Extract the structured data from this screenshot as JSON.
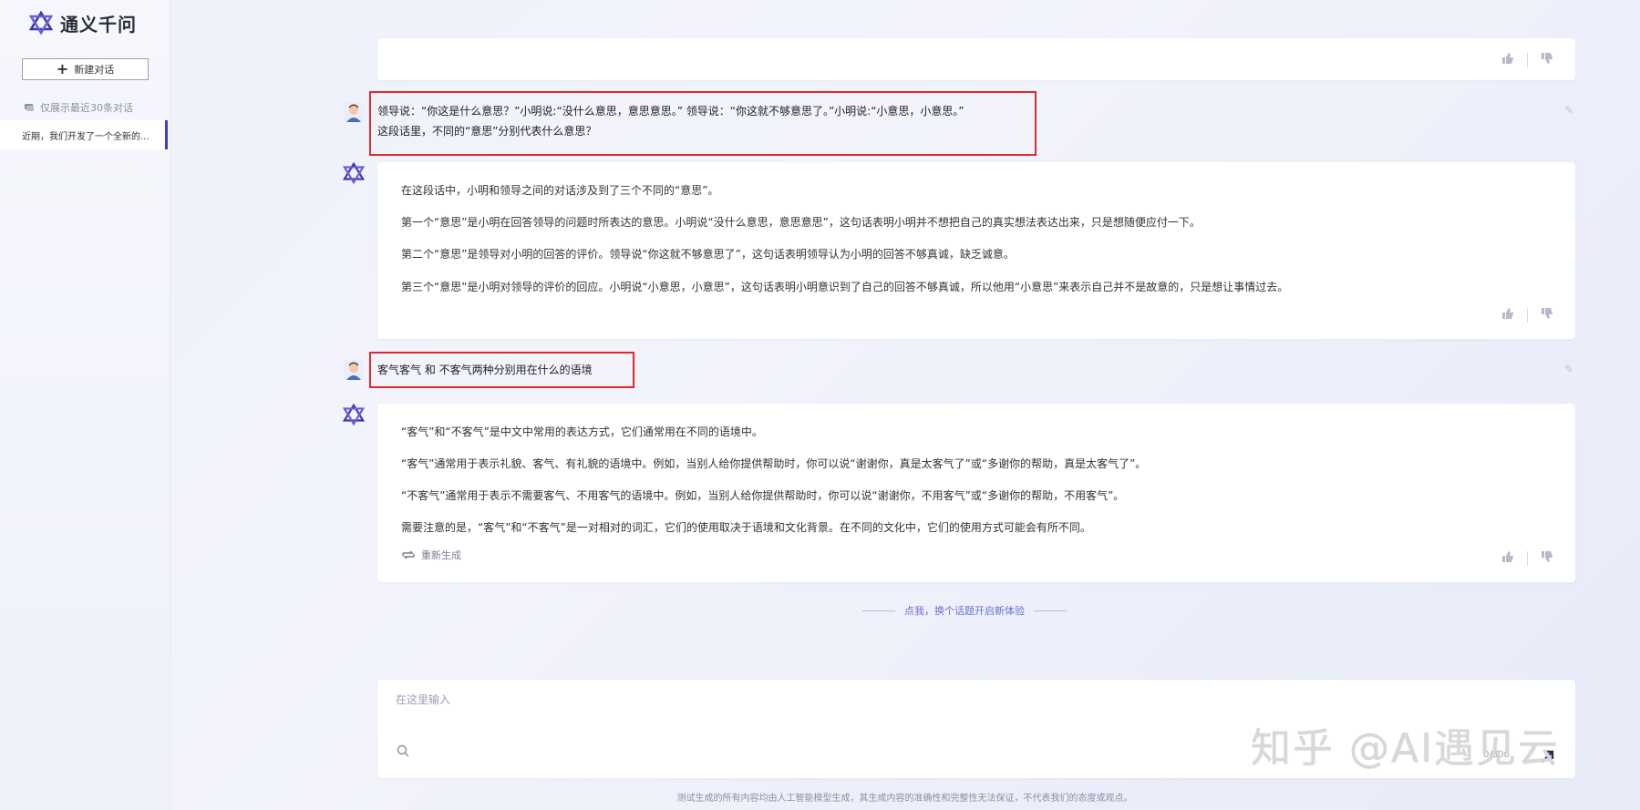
{
  "app": {
    "title": "通义千问"
  },
  "sidebar": {
    "new_chat_label": "新建对话",
    "history_note": "仅展示最近30条对话",
    "history_items": [
      "近期，我们开发了一个全新的..."
    ]
  },
  "conversation": {
    "q1": {
      "lines": [
        "领导说：“你这是什么意思？”小明说:“没什么意思，意思意思。” 领导说：“你这就不够意思了。”小明说:“小意思，小意思。”",
        "这段话里，不同的“意思”分别代表什么意思？"
      ]
    },
    "a1": {
      "paragraphs": [
        "在这段话中，小明和领导之间的对话涉及到了三个不同的“意思”。",
        "第一个“意思”是小明在回答领导的问题时所表达的意思。小明说“没什么意思，意思意思”，这句话表明小明并不想把自己的真实想法表达出来，只是想随便应付一下。",
        "第二个“意思”是领导对小明的回答的评价。领导说“你这就不够意思了”，这句话表明领导认为小明的回答不够真诚，缺乏诚意。",
        "第三个“意思”是小明对领导的评价的回应。小明说“小意思，小意思”，这句话表明小明意识到了自己的回答不够真诚，所以他用“小意思”来表示自己并不是故意的，只是想让事情过去。"
      ]
    },
    "q2": {
      "text": "客气客气 和 不客气两种分别用在什么的语境"
    },
    "a2": {
      "paragraphs": [
        "“客气”和“不客气”是中文中常用的表达方式，它们通常用在不同的语境中。",
        "“客气”通常用于表示礼貌、客气、有礼貌的语境中。例如，当别人给你提供帮助时，你可以说“谢谢你，真是太客气了”或“多谢你的帮助，真是太客气了”。",
        "“不客气”通常用于表示不需要客气、不用客气的语境中。例如，当别人给你提供帮助时，你可以说“谢谢你，不用客气”或“多谢你的帮助，不用客气”。",
        "需要注意的是，“客气”和“不客气”是一对相对的词汇，它们的使用取决于语境和文化背景。在不同的文化中，它们的使用方式可能会有所不同。"
      ],
      "regenerate_label": "重新生成"
    }
  },
  "new_topic_label": "点我，换个话题开启新体验",
  "input": {
    "placeholder": "在这里输入",
    "counter": "0/500"
  },
  "watermark": "知乎 @AI遇见云",
  "disclaimer": "测试生成的所有内容均由人工智能模型生成，其生成内容的准确性和完整性无法保证，不代表我们的态度或观点。",
  "colors": {
    "accent": "#3f3fbf",
    "highlight_box": "#e0282e"
  }
}
